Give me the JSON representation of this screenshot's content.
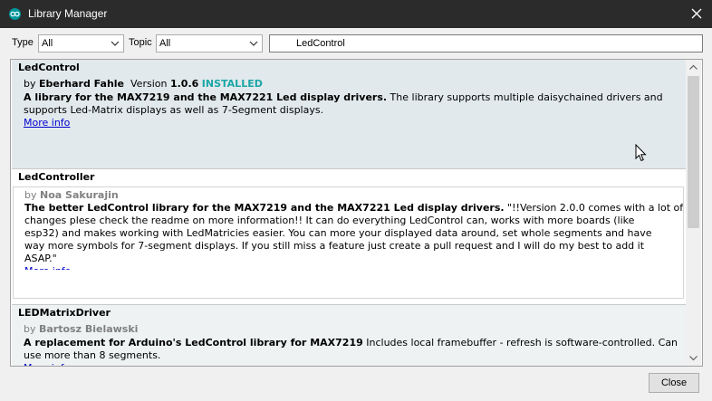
{
  "window": {
    "title": "Library Manager",
    "app_icon": "arduino-icon"
  },
  "filters": {
    "type_label": "Type",
    "type_value": "All",
    "topic_label": "Topic",
    "topic_value": "All",
    "search_value": "LedControl"
  },
  "libraries": [
    {
      "name": "LedControl",
      "by": "by",
      "author": "Eberhard Fahle",
      "version_label": "Version",
      "version": "1.0.6",
      "status": "INSTALLED",
      "desc_bold": "A library for the MAX7219 and the MAX7221 Led display drivers.",
      "desc_line1_rest": " The library supports multiple daisychained drivers and",
      "desc_line2": "supports Led-Matrix displays as well as 7-Segment displays.",
      "more_info": "More info"
    },
    {
      "name": "LedController",
      "by": "by",
      "author": "Noa Sakurajin",
      "desc_bold": "The better LedControl library for the MAX7219 and the MAX7221 Led display drivers.",
      "desc_line1_rest": " \"!!Version 2.0.0 comes with a lot of",
      "desc_line2": "changes plese check the readme on more information!! It can do everything LedControl can, works with more boards (like",
      "desc_line3": "esp32) and makes working with LedMatricies easier. You can more your displayed data around, set whole segments and have",
      "desc_line4": "way more symbols for 7-segment displays. If you still miss a feature just create a pull request and I will do my best to add it",
      "desc_line5": "ASAP.\"",
      "more_info": "More info"
    },
    {
      "name": "LEDMatrixDriver",
      "by": "by",
      "author": "Bartosz Bielawski",
      "desc_bold": "A replacement for Arduino's LedControl library for MAX7219",
      "desc_line1_rest": " Includes local framebuffer - refresh is software-controlled. Can",
      "desc_line2": "use more than 8 segments.",
      "more_info": "More info"
    }
  ],
  "buttons": {
    "close": "Close"
  },
  "colors": {
    "installed": "#1aa6a6",
    "titlebar": "#2b2b2b",
    "link": "#0000cc"
  }
}
